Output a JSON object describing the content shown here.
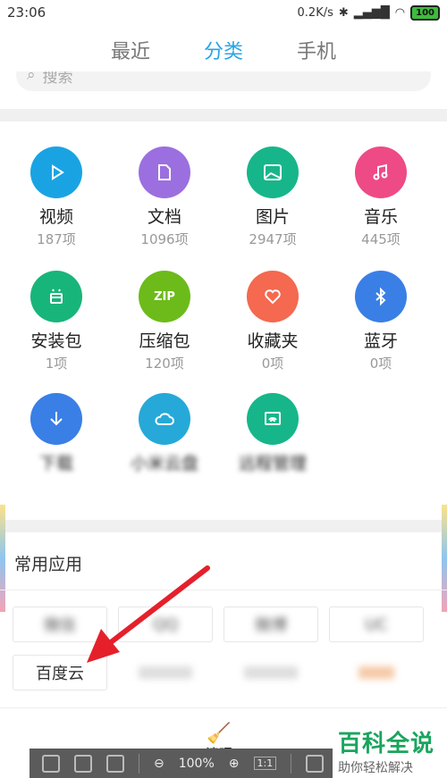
{
  "status_bar": {
    "time": "23:06",
    "speed": "0.2K/s",
    "battery": "100"
  },
  "tabs": [
    {
      "label": "最近",
      "active": false
    },
    {
      "label": "分类",
      "active": true
    },
    {
      "label": "手机",
      "active": false
    }
  ],
  "search": {
    "placeholder": "搜索"
  },
  "categories": [
    {
      "name": "视频",
      "count": "187项",
      "color": "#1aa3e3",
      "icon": "play-icon"
    },
    {
      "name": "文档",
      "count": "1096项",
      "color": "#9b6fe0",
      "icon": "document-icon"
    },
    {
      "name": "图片",
      "count": "2947项",
      "color": "#17b68a",
      "icon": "image-icon"
    },
    {
      "name": "音乐",
      "count": "445项",
      "color": "#ee4a86",
      "icon": "music-icon"
    },
    {
      "name": "安装包",
      "count": "1项",
      "color": "#18b57b",
      "icon": "android-icon"
    },
    {
      "name": "压缩包",
      "count": "120项",
      "color": "#6cbb1a",
      "icon": "zip-icon"
    },
    {
      "name": "收藏夹",
      "count": "0项",
      "color": "#f4694f",
      "icon": "heart-icon"
    },
    {
      "name": "蓝牙",
      "count": "0项",
      "color": "#3a7fe6",
      "icon": "bluetooth-icon"
    },
    {
      "name": "下载",
      "count": "",
      "color": "#3a7fe6",
      "icon": "download-icon"
    },
    {
      "name": "小米云盘",
      "count": "",
      "color": "#26a9d8",
      "icon": "cloud-icon"
    },
    {
      "name": "远程管理",
      "count": "",
      "color": "#17b68a",
      "icon": "remote-icon"
    }
  ],
  "common_apps": {
    "title": "常用应用",
    "items": [
      "微信",
      "QQ",
      "微博",
      "UC",
      "百度云",
      "",
      "",
      ""
    ]
  },
  "bottom": {
    "clean_label": "清理"
  },
  "toolbar": {
    "zoom": "100%",
    "ratio": "1:1"
  },
  "watermark": {
    "title": "百科全说",
    "subtitle": "助你轻松解决"
  },
  "annotation_arrow_color": "#e5202b",
  "zip_text": "ZIP"
}
